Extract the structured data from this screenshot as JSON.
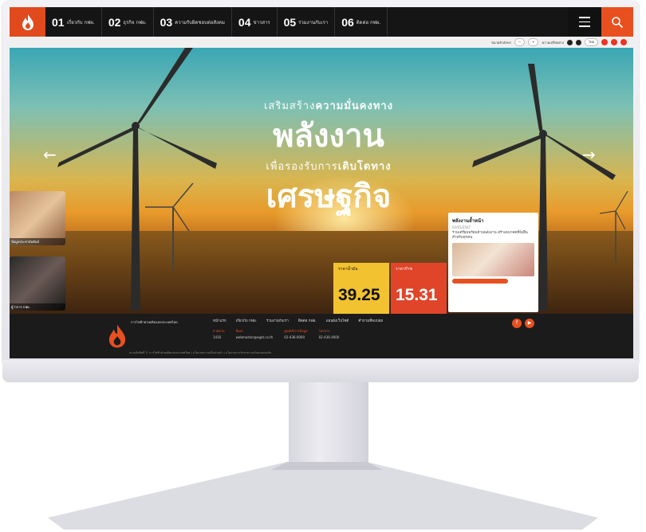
{
  "nav": {
    "items": [
      {
        "num": "01",
        "label": "เกี่ยวกับ กฟผ."
      },
      {
        "num": "02",
        "label": "ธุรกิจ กฟผ."
      },
      {
        "num": "03",
        "label": "ความรับผิดชอบต่อสังคม"
      },
      {
        "num": "04",
        "label": "ข่าวสาร"
      },
      {
        "num": "05",
        "label": "ร่วมงานกับเรา"
      },
      {
        "num": "06",
        "label": "ติดต่อ กฟผ."
      }
    ]
  },
  "util": {
    "font_size_label": "ขนาดตัวอักษร",
    "contrast_label": "ความเปรียบต่าง",
    "lang": "ไทย"
  },
  "hero": {
    "line1_a": "เสริมสร้าง",
    "line1_b": "ความมั่นคงทาง",
    "big1": "พลังงาน",
    "line2_a": "เพื่อรองรับการ",
    "line2_b": "เติบโตทาง",
    "big2": "เศรษฐกิจ",
    "prev": "←",
    "next": "→"
  },
  "cards": [
    {
      "caption": "ข้อมูลประชาสัมพันธ์"
    },
    {
      "caption": "ผู้ว่าการ กฟผ."
    }
  ],
  "prices": [
    {
      "label": "ราคาน้ำมัน",
      "value": "39.25"
    },
    {
      "label": "ราคาก๊าซ",
      "value": "15.31"
    }
  ],
  "news": {
    "title": "พลังงานล้ำหน้า",
    "date": "02/01/2567",
    "body": "ร่วมเตรียมพร้อมด้านพลังงาน สร้างอนาคตที่ยั่งยืนสำหรับทุกคน"
  },
  "footer": {
    "org": "การไฟฟ้าฝ่ายผลิตแห่งประเทศไทย",
    "links": [
      "หน้าแรก",
      "เกี่ยวกับ กฟผ.",
      "ร่วมงานกับเรา",
      "ติดต่อ กฟผ.",
      "แผนผังเว็บไซต์",
      "คำถามที่พบบ่อย"
    ],
    "cols": [
      {
        "h": "สายด่วน",
        "v": "1416"
      },
      {
        "h": "อีเมล",
        "v": "webmaster@egat.co.th"
      },
      {
        "h": "ศูนย์บริการข้อมูล",
        "v": "02-436-0000"
      },
      {
        "h": "โทรสาร",
        "v": "02-436-4000"
      }
    ],
    "bottom": "สงวนลิขสิทธิ์ © การไฟฟ้าฝ่ายผลิตแห่งประเทศไทย | นโยบายความเป็นส่วนตัว | นโยบายการรักษาความมั่นคงปลอดภัย"
  },
  "colors": {
    "accent": "#e8501f",
    "nav_bg": "#151515"
  }
}
